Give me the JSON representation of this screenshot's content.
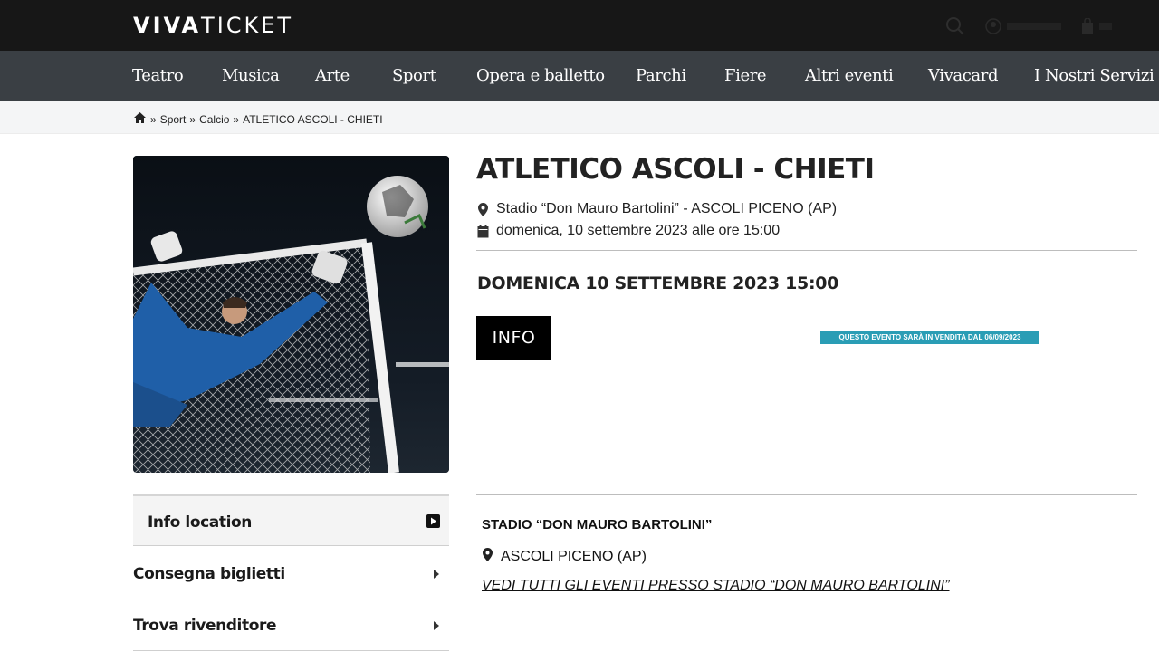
{
  "header": {
    "logo_bold": "VIVA",
    "logo_light": "TICKET",
    "icons": [
      "search-icon",
      "user-icon",
      "cart-icon"
    ]
  },
  "nav": {
    "items": [
      "Teatro",
      "Musica",
      "Arte",
      "Sport",
      "Opera e balletto",
      "Parchi",
      "Fiere",
      "Altri eventi",
      "Vivacard",
      "I Nostri Servizi"
    ]
  },
  "breadcrumb": {
    "items": [
      "Sport",
      "Calcio",
      "ATLETICO ASCOLI - CHIETI"
    ],
    "separator": "»"
  },
  "event": {
    "title": "ATLETICO ASCOLI - CHIETI",
    "venue": "Stadio “Don Mauro Bartolini” - ASCOLI PICENO (AP)",
    "datetime": "domenica, 10 settembre 2023 alle ore 15:00",
    "date_heading": "DOMENICA 10 SETTEMBRE 2023 15:00",
    "info_button": "INFO",
    "sale_badge": "QUESTO EVENTO SARÀ IN VENDITA DAL 06/09/2023"
  },
  "accordion": {
    "items": [
      "Info location",
      "Consegna biglietti",
      "Trova rivenditore"
    ]
  },
  "location": {
    "name": "STADIO “DON MAURO BARTOLINI”",
    "city": "ASCOLI PICENO (AP)",
    "link": "VEDI TUTTI GLI EVENTI PRESSO STADIO “DON MAURO BARTOLINI”"
  },
  "colors": {
    "topbar": "#171717",
    "nav": "#3a3f44",
    "badge": "#2a9db5"
  }
}
